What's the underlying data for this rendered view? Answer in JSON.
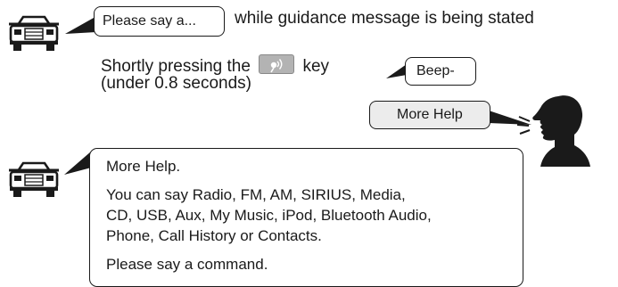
{
  "step1": {
    "bubble_text": "Please say a...",
    "trailing_text": "while guidance message is being stated"
  },
  "step2": {
    "line1_before": "Shortly pressing the",
    "key_icon": "voice-talk-icon",
    "line1_after": "key",
    "line2": "(under 0.8 seconds)",
    "beep_text": "Beep-"
  },
  "user_speech": {
    "bubble_text": "More Help",
    "person_icon": "speaking-person-icon"
  },
  "system_response": {
    "lines": [
      "More Help.",
      "You can say Radio, FM, AM, SIRIUS, Media,",
      "CD, USB, Aux, My Music, iPod, Bluetooth Audio,",
      "Phone, Call History or Contacts.",
      "Please say a command."
    ]
  },
  "colors": {
    "ink": "#1a1a1a",
    "bubble_gray": "#ececec",
    "key_gray": "#b3b3b3"
  }
}
